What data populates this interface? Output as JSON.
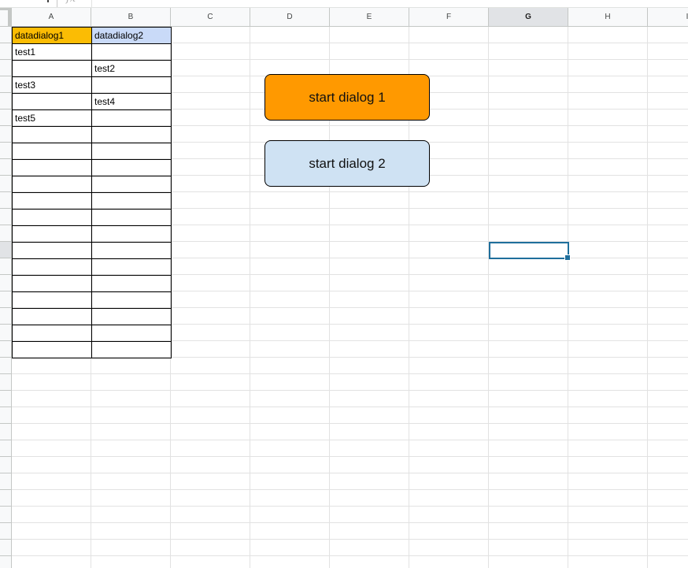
{
  "formula_bar": {
    "fx_icon": "fx"
  },
  "columns": [
    "A",
    "B",
    "C",
    "D",
    "E",
    "F",
    "G",
    "H",
    "I"
  ],
  "active_column": "G",
  "active_row_index": 13,
  "cells": [
    {
      "name": "cell-a1",
      "col": 0,
      "row": 0,
      "text": "datadialog1",
      "bg": "#fbbc04"
    },
    {
      "name": "cell-b1",
      "col": 1,
      "row": 0,
      "text": "datadialog2",
      "bg": "#c9daf8"
    },
    {
      "name": "cell-a2",
      "col": 0,
      "row": 1,
      "text": "test1"
    },
    {
      "name": "cell-b2",
      "col": 1,
      "row": 1,
      "text": ""
    },
    {
      "name": "cell-a3",
      "col": 0,
      "row": 2,
      "text": ""
    },
    {
      "name": "cell-b3",
      "col": 1,
      "row": 2,
      "text": "test2"
    },
    {
      "name": "cell-a4",
      "col": 0,
      "row": 3,
      "text": "test3"
    },
    {
      "name": "cell-b4",
      "col": 1,
      "row": 3,
      "text": ""
    },
    {
      "name": "cell-a5",
      "col": 0,
      "row": 4,
      "text": ""
    },
    {
      "name": "cell-b5",
      "col": 1,
      "row": 4,
      "text": "test4"
    },
    {
      "name": "cell-a6",
      "col": 0,
      "row": 5,
      "text": "test5"
    },
    {
      "name": "cell-b6",
      "col": 1,
      "row": 5,
      "text": ""
    }
  ],
  "bordered_rows": 20,
  "buttons": {
    "dialog1": {
      "label": "start dialog 1",
      "color": "#ff9900"
    },
    "dialog2": {
      "label": "start dialog 2",
      "color": "#cfe2f3"
    }
  },
  "colors": {
    "header_bg": "#f8f9fa",
    "gridline": "#e2e2e2",
    "selection": "#1f6f9c"
  }
}
